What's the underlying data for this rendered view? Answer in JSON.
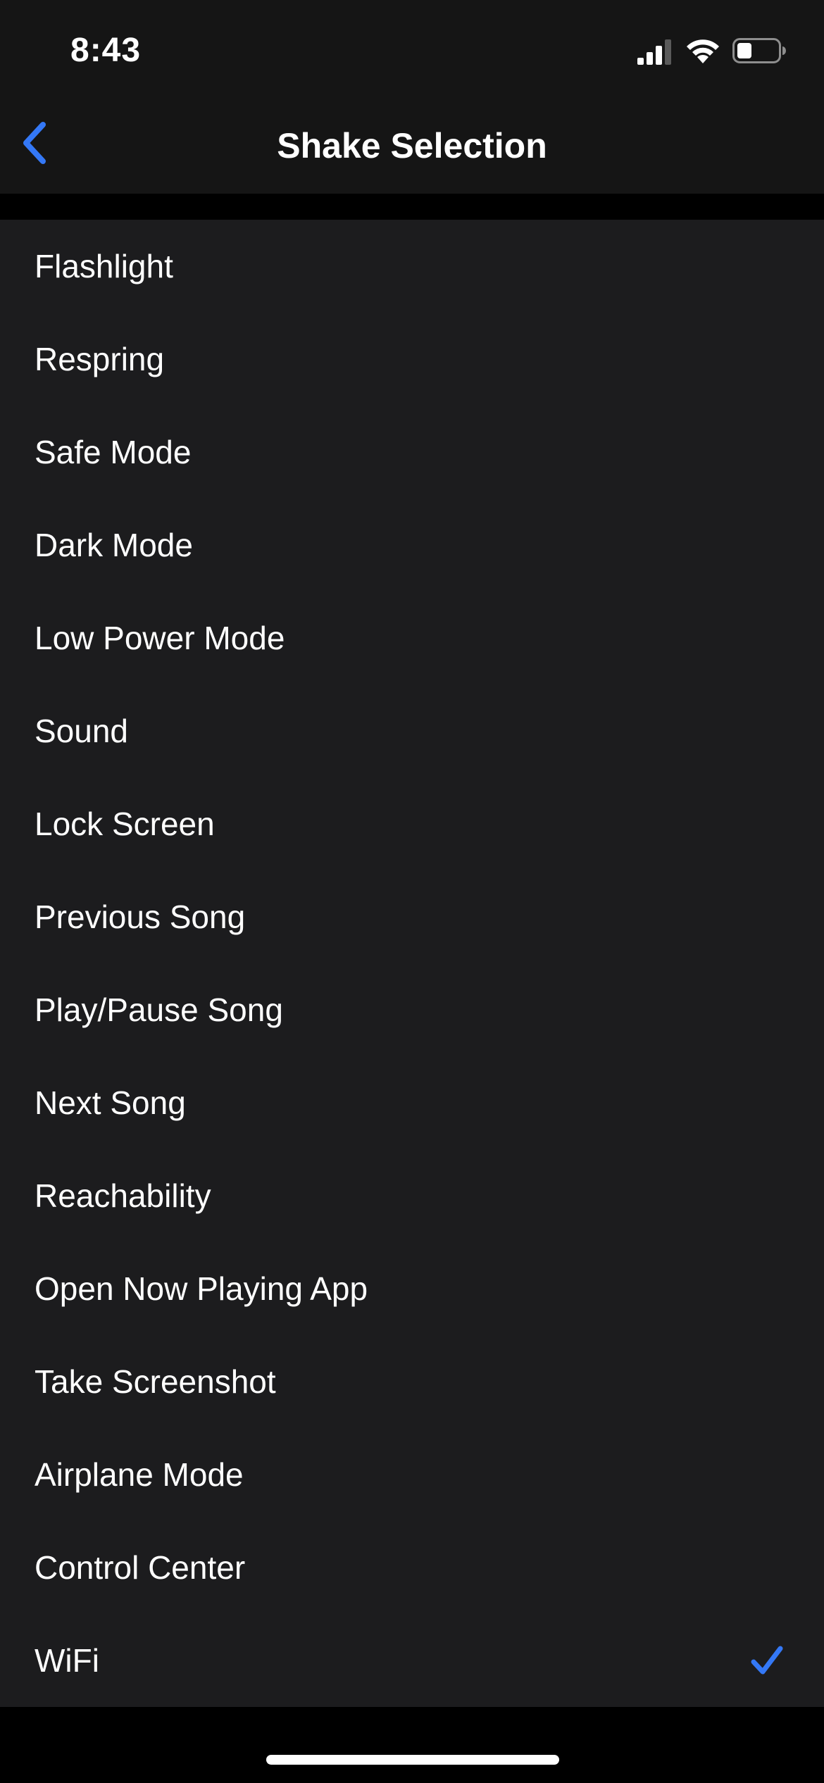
{
  "status_bar": {
    "time": "8:43",
    "icons": [
      "signal-icon",
      "wifi-icon",
      "battery-icon"
    ],
    "battery_level": 0.35
  },
  "nav": {
    "title": "Shake Selection",
    "back_icon": "chevron-left-icon"
  },
  "list": {
    "items": [
      {
        "label": "Flashlight",
        "selected": false
      },
      {
        "label": "Respring",
        "selected": false
      },
      {
        "label": "Safe Mode",
        "selected": false
      },
      {
        "label": "Dark Mode",
        "selected": false
      },
      {
        "label": "Low Power Mode",
        "selected": false
      },
      {
        "label": "Sound",
        "selected": false
      },
      {
        "label": "Lock Screen",
        "selected": false
      },
      {
        "label": "Previous Song",
        "selected": false
      },
      {
        "label": "Play/Pause Song",
        "selected": false
      },
      {
        "label": "Next Song",
        "selected": false
      },
      {
        "label": "Reachability",
        "selected": false
      },
      {
        "label": "Open Now Playing App",
        "selected": false
      },
      {
        "label": "Take Screenshot",
        "selected": false
      },
      {
        "label": "Airplane Mode",
        "selected": false
      },
      {
        "label": "Control Center",
        "selected": false
      },
      {
        "label": "WiFi",
        "selected": true
      }
    ]
  },
  "colors": {
    "accent": "#3478f6",
    "background": "#000000",
    "bar_background": "#151515",
    "row_background": "#1c1c1e",
    "text": "#ffffff"
  }
}
